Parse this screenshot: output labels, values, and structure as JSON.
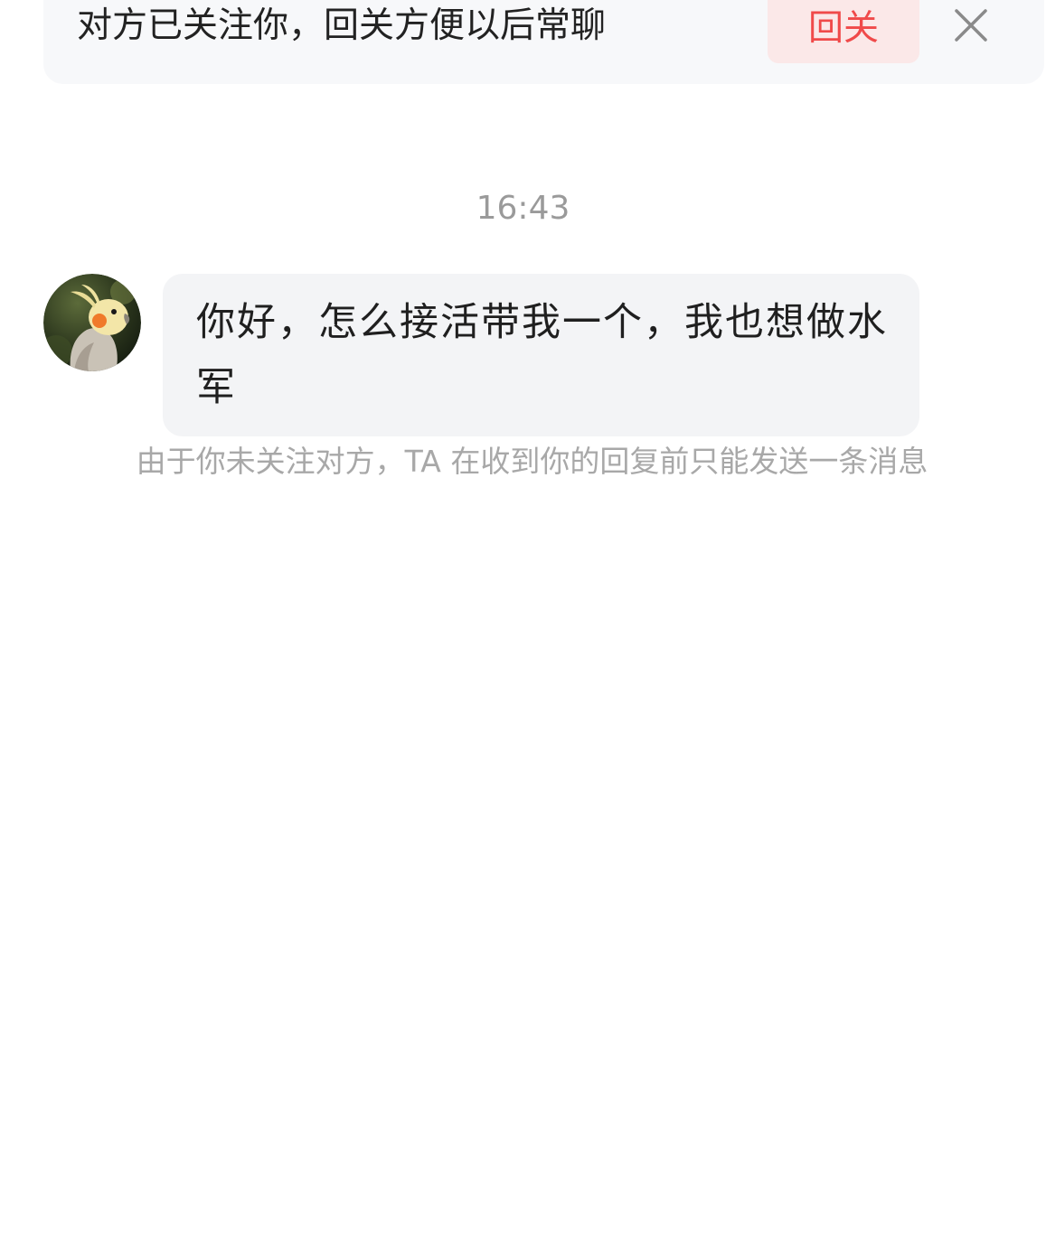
{
  "follow_banner": {
    "text": "对方已关注你，回关方便以后常聊",
    "follow_back_label": "回关",
    "close_icon": "close-icon"
  },
  "chat": {
    "timestamp": "16:43",
    "messages": [
      {
        "sender": "other",
        "avatar_icon": "cockatiel-avatar",
        "text": "你好，怎么接活带我一个，我也想做水军"
      }
    ],
    "notice": "由于你未关注对方，TA 在收到你的回复前只能发送一条消息"
  },
  "colors": {
    "accent_red": "#f04a4a",
    "banner_bg": "#f7f8fa",
    "bubble_bg": "#f3f4f6",
    "muted_text": "#9a9a9a"
  }
}
